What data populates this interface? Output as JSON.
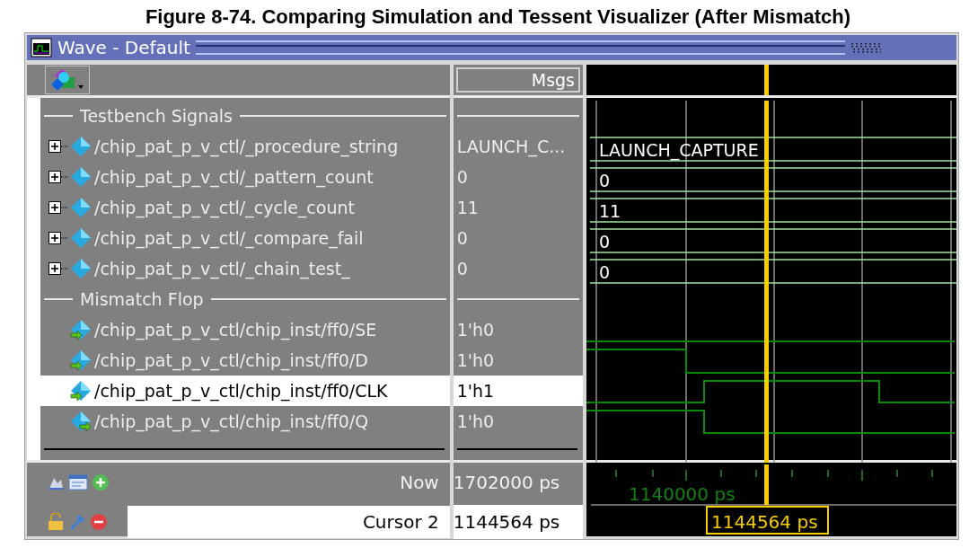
{
  "caption": "Figure 8-74. Comparing Simulation and Tessent Visualizer (After Mismatch)",
  "window": {
    "title": "Wave - Default"
  },
  "values_header": "Msgs",
  "groups": [
    {
      "label": "Testbench Signals",
      "signals": [
        {
          "kind": "bus",
          "name": "/chip_pat_p_v_ctl/_procedure_string",
          "value": "LAUNCH_C...",
          "wave_label": "LAUNCH_CAPTURE",
          "expanded": false,
          "selected": false
        },
        {
          "kind": "bus",
          "name": "/chip_pat_p_v_ctl/_pattern_count",
          "value": "0",
          "wave_label": "0",
          "expanded": false,
          "selected": false
        },
        {
          "kind": "bus",
          "name": "/chip_pat_p_v_ctl/_cycle_count",
          "value": "11",
          "wave_label": "11",
          "expanded": false,
          "selected": false
        },
        {
          "kind": "bus",
          "name": "/chip_pat_p_v_ctl/_compare_fail",
          "value": "0",
          "wave_label": "0",
          "expanded": false,
          "selected": false
        },
        {
          "kind": "bus",
          "name": "/chip_pat_p_v_ctl/_chain_test_",
          "value": "0",
          "wave_label": "0",
          "expanded": false,
          "selected": false
        }
      ]
    },
    {
      "label": "Mismatch Flop",
      "signals": [
        {
          "kind": "in",
          "name": "/chip_pat_p_v_ctl/chip_inst/ff0/SE",
          "value": "1'h0",
          "selected": false
        },
        {
          "kind": "in",
          "name": "/chip_pat_p_v_ctl/chip_inst/ff0/D",
          "value": "1'h0",
          "selected": false
        },
        {
          "kind": "in",
          "name": "/chip_pat_p_v_ctl/chip_inst/ff0/CLK",
          "value": "1'h1",
          "selected": true
        },
        {
          "kind": "out",
          "name": "/chip_pat_p_v_ctl/chip_inst/ff0/Q",
          "value": "1'h0",
          "selected": false
        }
      ]
    }
  ],
  "footer": {
    "now_label": "Now",
    "now_value": "1702000 ps",
    "cursor_label": "Cursor 2",
    "cursor_value": "1144564 ps",
    "time_label": "1140000 ps",
    "cursor_time": "1144564 ps"
  }
}
